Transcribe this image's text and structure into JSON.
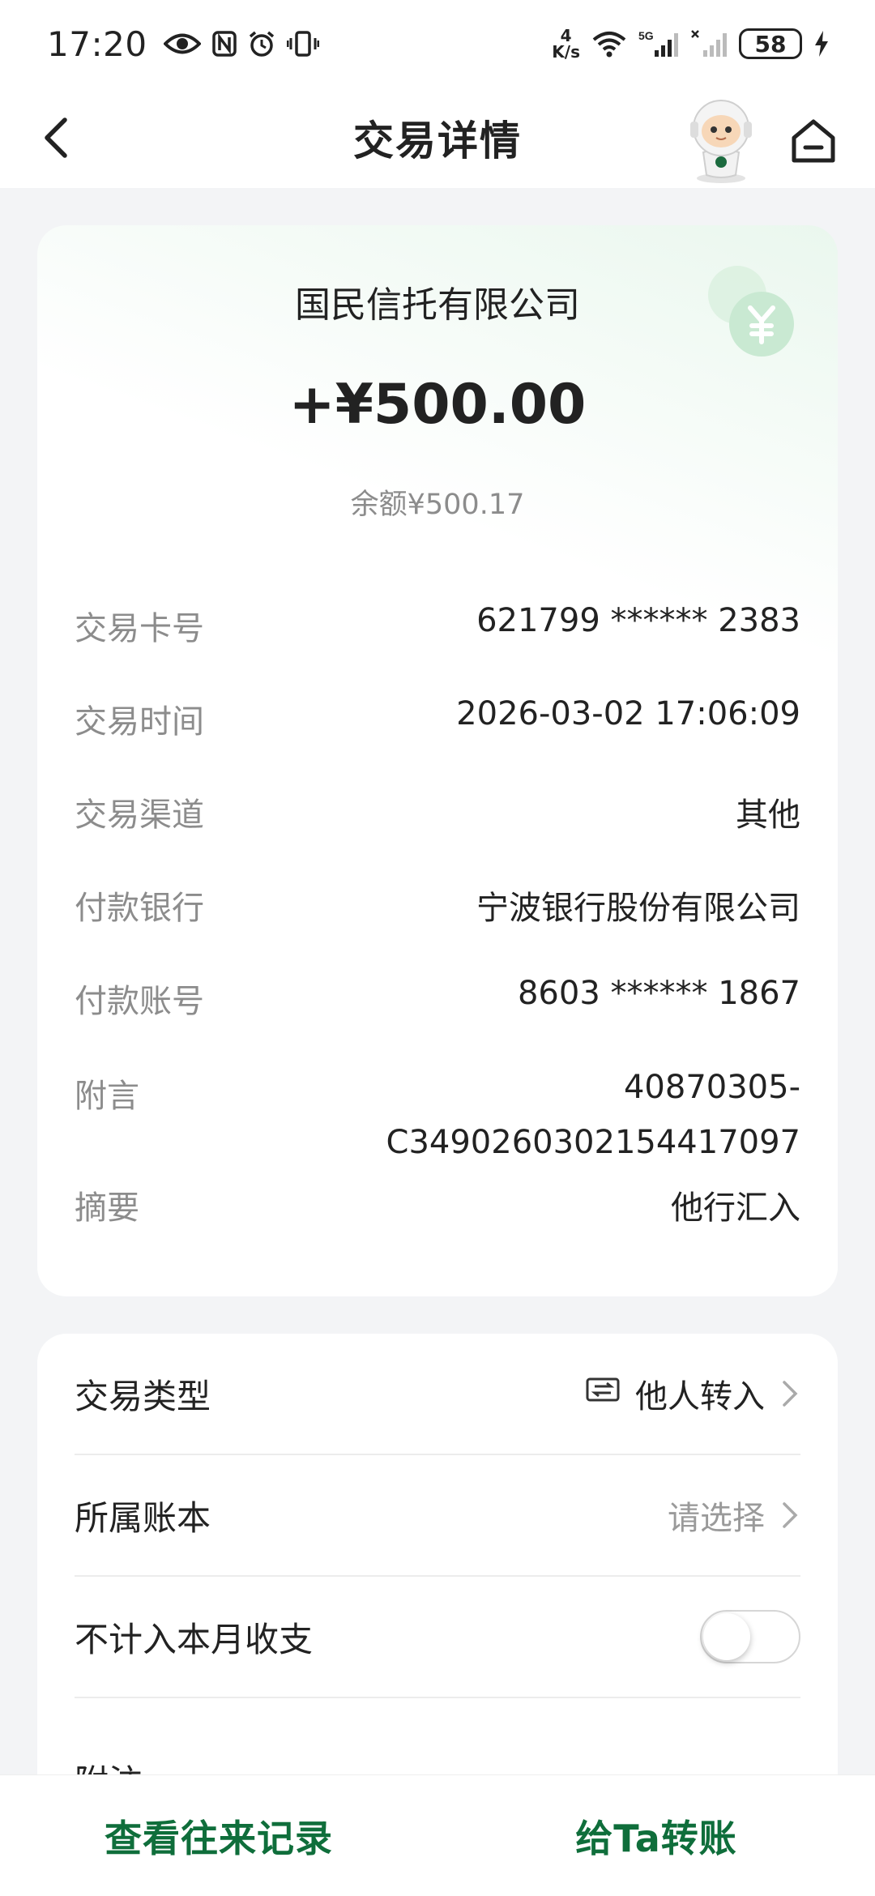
{
  "status_bar": {
    "time": "17:20",
    "net_speed_value": "4",
    "net_speed_unit": "K/s",
    "network": "5G",
    "battery": "58",
    "icons": [
      "eye-icon",
      "nfc-icon",
      "alarm-icon",
      "vibrate-icon",
      "wifi-icon",
      "signal-icon",
      "signal-off-icon",
      "charging-icon"
    ]
  },
  "header": {
    "title": "交易详情",
    "icons": [
      "back-icon",
      "mascot-icon",
      "home-icon"
    ]
  },
  "transaction": {
    "counterparty": "国民信托有限公司",
    "amount": "+¥500.00",
    "balance": "余额¥500.17",
    "details": [
      {
        "label": "交易卡号",
        "value": "621799 ****** 2383"
      },
      {
        "label": "交易时间",
        "value": "2026-03-02 17:06:09"
      },
      {
        "label": "交易渠道",
        "value": "其他"
      },
      {
        "label": "付款银行",
        "value": "宁波银行股份有限公司"
      },
      {
        "label": "付款账号",
        "value": "8603 ****** 1867"
      },
      {
        "label": "附言",
        "value_line1": "40870305-",
        "value_line2": "C3490260302154417097"
      },
      {
        "label": "摘要",
        "value": "他行汇入"
      }
    ]
  },
  "options": {
    "type_label": "交易类型",
    "type_value": "他人转入",
    "book_label": "所属账本",
    "book_placeholder": "请选择",
    "exclude_label": "不计入本月收支",
    "exclude_on": false,
    "note_label": "附注"
  },
  "bottom_bar": {
    "history_label": "查看往来记录",
    "transfer_label": "给Ta转账"
  },
  "colors": {
    "accent_green": "#0f6e3b",
    "background": "#f3f4f6"
  }
}
